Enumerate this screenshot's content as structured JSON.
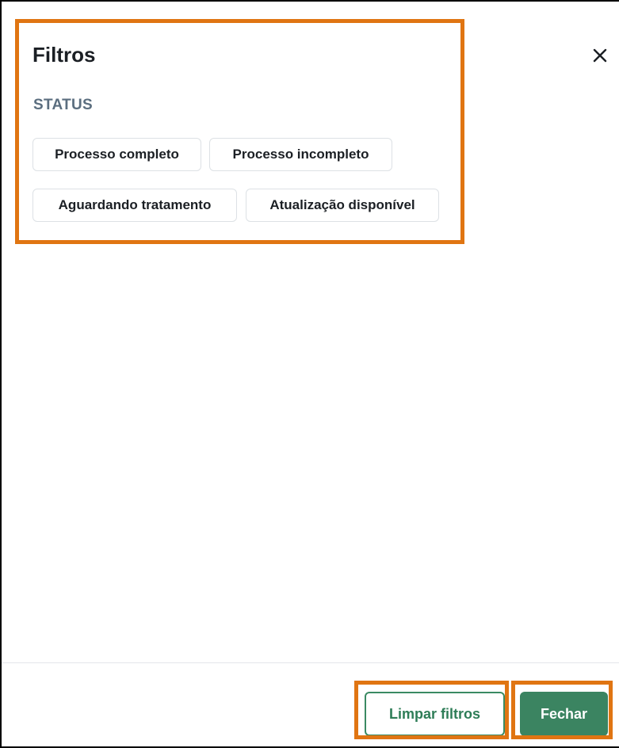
{
  "panel": {
    "title": "Filtros",
    "close_icon": "close-icon"
  },
  "status": {
    "label": "STATUS",
    "options": [
      "Processo completo",
      "Processo incompleto",
      "Aguardando tratamento",
      "Atualização disponível"
    ]
  },
  "footer": {
    "clear_label": "Limpar filtros",
    "close_label": "Fechar"
  },
  "colors": {
    "primary_green": "#3b8461",
    "highlight_orange": "#e07512",
    "section_label": "#5b6e7f"
  }
}
